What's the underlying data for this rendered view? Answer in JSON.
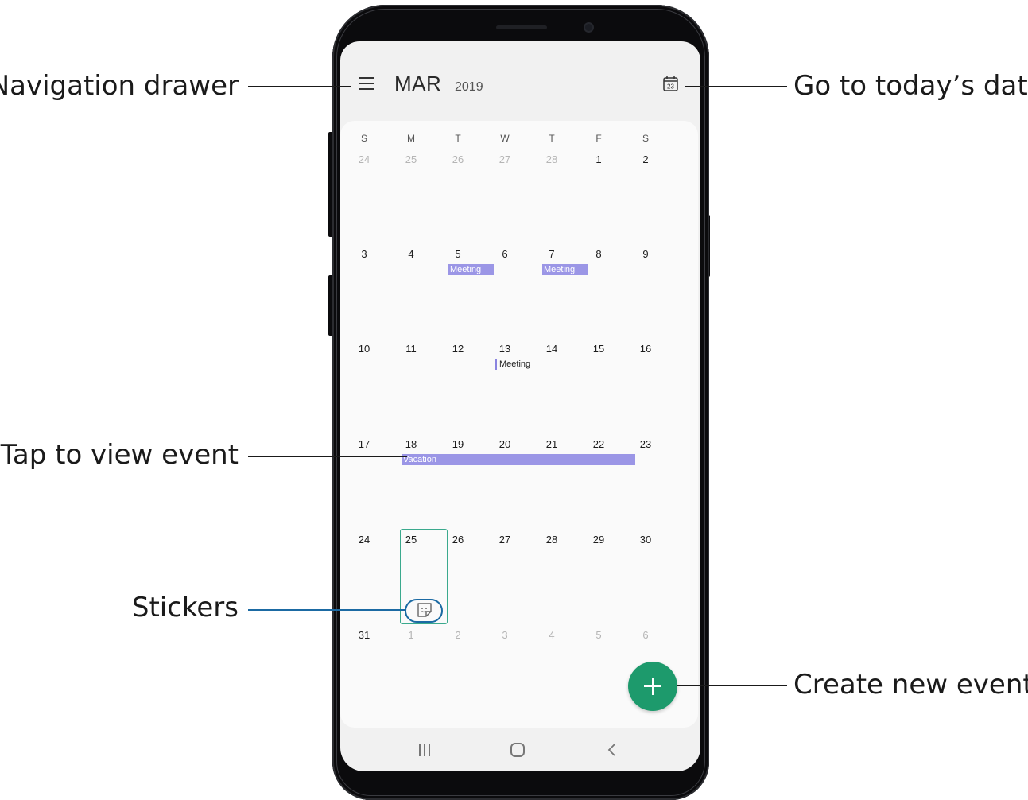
{
  "app_bar": {
    "month": "MAR",
    "year": "2019",
    "today_icon_day": "23"
  },
  "weekdays": [
    "S",
    "M",
    "T",
    "W",
    "T",
    "F",
    "S"
  ],
  "weeks": [
    {
      "days": [
        "24",
        "25",
        "26",
        "27",
        "28",
        "1",
        "2"
      ],
      "dim": [
        true,
        true,
        true,
        true,
        true,
        false,
        false
      ]
    },
    {
      "days": [
        "3",
        "4",
        "5",
        "6",
        "7",
        "8",
        "9"
      ],
      "dim": [
        false,
        false,
        false,
        false,
        false,
        false,
        false
      ]
    },
    {
      "days": [
        "10",
        "11",
        "12",
        "13",
        "14",
        "15",
        "16"
      ],
      "dim": [
        false,
        false,
        false,
        false,
        false,
        false,
        false
      ]
    },
    {
      "days": [
        "17",
        "18",
        "19",
        "20",
        "21",
        "22",
        "23"
      ],
      "dim": [
        false,
        false,
        false,
        false,
        false,
        false,
        false
      ]
    },
    {
      "days": [
        "24",
        "25",
        "26",
        "27",
        "28",
        "29",
        "30"
      ],
      "dim": [
        false,
        false,
        false,
        false,
        false,
        false,
        false
      ]
    },
    {
      "days": [
        "31",
        "1",
        "2",
        "3",
        "4",
        "5",
        "6"
      ],
      "dim": [
        false,
        true,
        true,
        true,
        true,
        true,
        true
      ]
    }
  ],
  "events": {
    "meeting_mar5": "Meeting",
    "meeting_mar7": "Meeting",
    "meeting_mar13": "Meeting",
    "vacation": "Vacation"
  },
  "callouts": {
    "navigation_drawer": "Navigation drawer",
    "go_to_today": "Go to today’s date",
    "tap_to_view_event": "Tap to view event",
    "stickers": "Stickers",
    "create_new_event": "Create new event"
  },
  "colors": {
    "event": "#9b96e6",
    "fab": "#1d9a6c",
    "selection": "#3aa98d",
    "callout_highlight": "#1b6aa3"
  }
}
